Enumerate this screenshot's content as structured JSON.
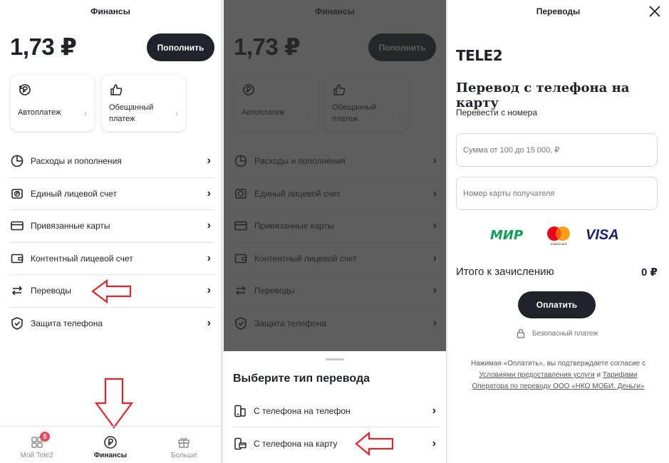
{
  "screen1": {
    "title": "Финансы",
    "balance": "1,73 ₽",
    "topup_label": "Пополнить",
    "cards": [
      {
        "icon": "autopay-icon",
        "label_line1": "Автоплатеж",
        "label_line2": ""
      },
      {
        "icon": "thumbs-up-icon",
        "label_line1": "Обещанный",
        "label_line2": "платеж"
      }
    ],
    "menu": [
      {
        "icon": "pie-chart-icon",
        "label": "Расходы и пополнения"
      },
      {
        "icon": "account-icon",
        "label": "Единый лицевой счет"
      },
      {
        "icon": "card-icon",
        "label": "Привязанные карты"
      },
      {
        "icon": "wallet-icon",
        "label": "Контентный лицевой счет"
      },
      {
        "icon": "transfer-icon",
        "label": "Переводы"
      },
      {
        "icon": "shield-icon",
        "label": "Защита телефона"
      }
    ],
    "tabs": [
      {
        "icon": "grid-icon",
        "label": "Мой Tele2",
        "badge": "5"
      },
      {
        "icon": "ruble-icon",
        "label": "Финансы"
      },
      {
        "icon": "gift-icon",
        "label": "Больше"
      }
    ]
  },
  "screen2": {
    "sheet_title": "Выберите тип перевода",
    "options": [
      {
        "icon": "phone-to-phone-icon",
        "label": "С телефона на телефон"
      },
      {
        "icon": "phone-to-card-icon",
        "label": "С телефона на карту"
      }
    ]
  },
  "screen3": {
    "title": "Переводы",
    "logo": "TELE2",
    "heading": "Перевод с телефона на карту",
    "subheading": "Перевести с номера",
    "amount_placeholder": "Сумма от 100 до 15 000, ₽",
    "card_placeholder": "Номер карты получателя",
    "pay_systems": [
      "МИР",
      "mastercard",
      "VISA"
    ],
    "total_label": "Итого к зачислению",
    "total_value": "0 ₽",
    "pay_label": "Оплатить",
    "secure_label": "Безопасный платеж",
    "legal_prefix": "Нажимая «Оплатить», вы подтверждаете согласие с",
    "legal_link1": "Условиями предоставления услуги",
    "legal_and": " и ",
    "legal_link2a": "Тарифами",
    "legal_link2b": "Оператора по переводу ООО «НКО МОБИ. Деньги»"
  },
  "colors": {
    "dark": "#1f2229",
    "arrow": "#e8222c",
    "badge": "#e94a5f",
    "mir": "#0f9d58",
    "visa": "#1a1f71"
  }
}
